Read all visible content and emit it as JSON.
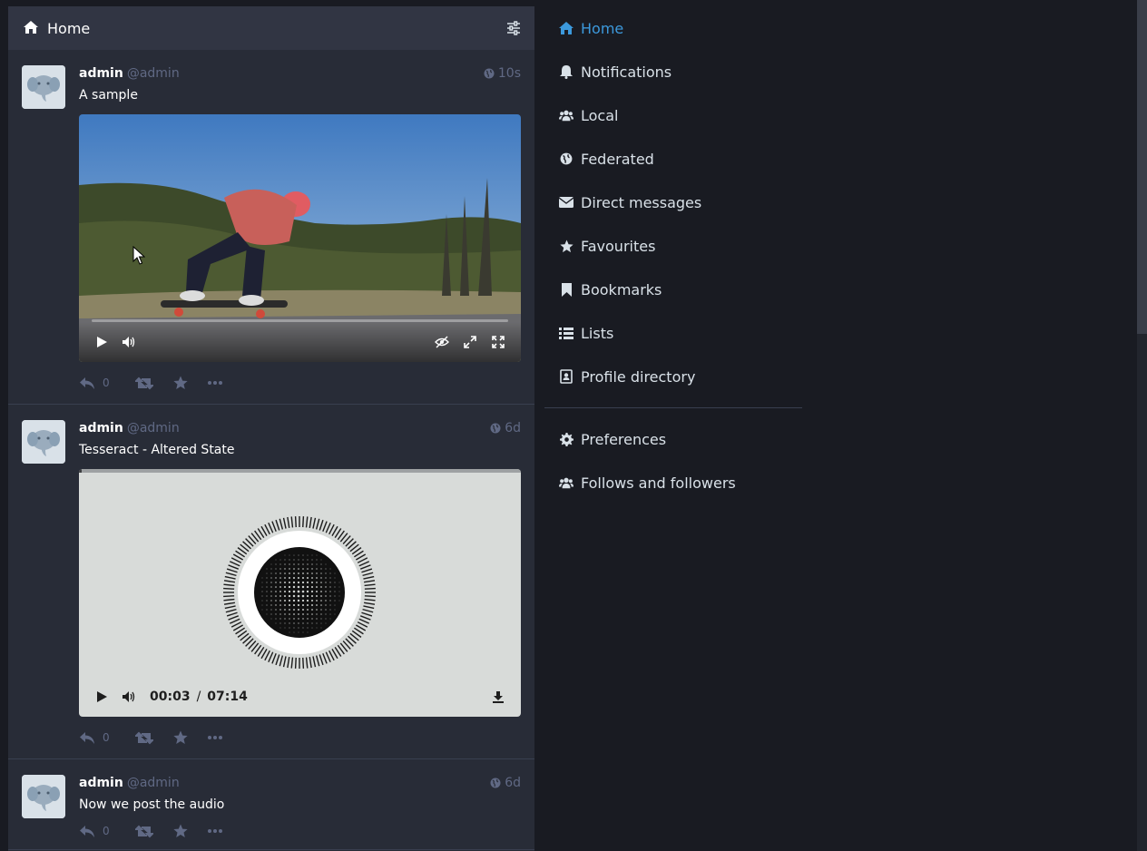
{
  "column": {
    "title": "Home"
  },
  "statuses": [
    {
      "display_name": "admin",
      "handle": "@admin",
      "time": "10s",
      "content": "A sample",
      "media_type": "video",
      "reply_count": "0"
    },
    {
      "display_name": "admin",
      "handle": "@admin",
      "time": "6d",
      "content": "Tesseract - Altered State",
      "media_type": "audio",
      "audio": {
        "current": "00:03",
        "separator": "/",
        "total": "07:14",
        "progress": 0.007
      },
      "reply_count": "0"
    },
    {
      "display_name": "admin",
      "handle": "@admin",
      "time": "6d",
      "content": "Now we post the audio",
      "media_type": "none",
      "reply_count": "0"
    }
  ],
  "navigation": {
    "items": [
      {
        "label": "Home",
        "icon": "home-icon",
        "active": true
      },
      {
        "label": "Notifications",
        "icon": "bell-icon"
      },
      {
        "label": "Local",
        "icon": "users-icon"
      },
      {
        "label": "Federated",
        "icon": "globe-icon"
      },
      {
        "label": "Direct messages",
        "icon": "envelope-icon"
      },
      {
        "label": "Favourites",
        "icon": "star-icon"
      },
      {
        "label": "Bookmarks",
        "icon": "bookmark-icon"
      },
      {
        "label": "Lists",
        "icon": "list-icon"
      },
      {
        "label": "Profile directory",
        "icon": "address-book-icon"
      }
    ],
    "secondary": [
      {
        "label": "Preferences",
        "icon": "gear-icon"
      },
      {
        "label": "Follows and followers",
        "icon": "users-icon"
      }
    ]
  },
  "colors": {
    "background": "#191b22",
    "column": "#282c37",
    "header": "#313543",
    "accent": "#3c99dc",
    "muted": "#606984",
    "nav_text": "#d9e1e8"
  }
}
